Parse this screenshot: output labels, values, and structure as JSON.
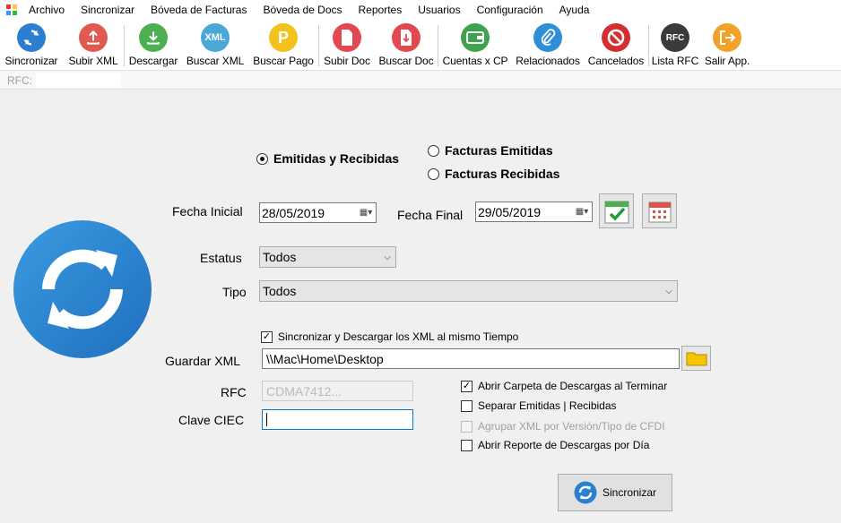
{
  "menu": [
    "Archivo",
    "Sincronizar",
    "Bóveda de Facturas",
    "Bóveda de Docs",
    "Reportes",
    "Usuarios",
    "Configuración",
    "Ayuda"
  ],
  "toolbar": {
    "sincronizar": "Sincronizar",
    "subir_xml": "Subir XML",
    "descargar": "Descargar",
    "buscar_xml": "Buscar XML",
    "buscar_pago": "Buscar Pago",
    "subir_doc": "Subir Doc",
    "buscar_doc": "Buscar Doc",
    "cuentas_cp": "Cuentas x CP",
    "relacionados": "Relacionados",
    "cancelados": "Cancelados",
    "lista_rfc": "Lista RFC",
    "salir": "Salir App.",
    "icon_xml_text": "XML",
    "icon_pago_text": "P",
    "icon_rfc_text": "RFC"
  },
  "rfc_strip": {
    "label": "RFC:",
    "value": ""
  },
  "form": {
    "radio_ambas": "Emitidas y Recibidas",
    "radio_emitidas": "Facturas Emitidas",
    "radio_recibidas": "Facturas Recibidas",
    "fecha_inicial_label": "Fecha Inicial",
    "fecha_inicial": "28/05/2019",
    "fecha_final_label": "Fecha Final",
    "fecha_final": "29/05/2019",
    "estatus_label": "Estatus",
    "estatus_value": "Todos",
    "tipo_label": "Tipo",
    "tipo_value": "Todos",
    "chk_sync_descarga": "Sincronizar y Descargar los XML al mismo Tiempo",
    "guardar_label": "Guardar XML",
    "guardar_value": "\\\\Mac\\Home\\Desktop",
    "rfc_label": "RFC",
    "rfc_value": "CDMA7412...",
    "clave_label": "Clave CIEC",
    "clave_value": "",
    "chk_abrir_carpeta": "Abrir Carpeta de Descargas al Terminar",
    "chk_separar": "Separar Emitidas | Recibidas",
    "chk_agrupar": "Agrupar XML por Versión/Tipo de CFDI",
    "chk_reporte": "Abrir Reporte de Descargas por Día",
    "sync_button": "Sincronizar"
  },
  "colors": {
    "sync_blue": "#2b7fd0",
    "red": "#e05a52",
    "green": "#4caf50",
    "teal": "#4aa8d8",
    "yellow": "#f3c21b",
    "pink": "#e4484f",
    "cancel_red": "#d32f2f",
    "dark": "#3a3a3a",
    "orange": "#f2a22b"
  }
}
